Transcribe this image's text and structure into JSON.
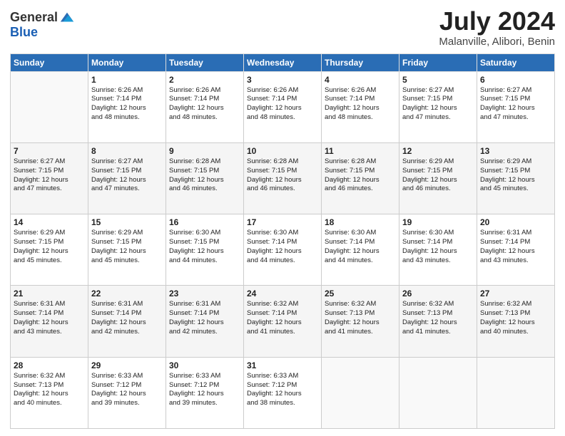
{
  "logo": {
    "general": "General",
    "blue": "Blue"
  },
  "title": {
    "month_year": "July 2024",
    "location": "Malanville, Alibori, Benin"
  },
  "headers": [
    "Sunday",
    "Monday",
    "Tuesday",
    "Wednesday",
    "Thursday",
    "Friday",
    "Saturday"
  ],
  "weeks": [
    [
      {
        "day": "",
        "info": ""
      },
      {
        "day": "1",
        "info": "Sunrise: 6:26 AM\nSunset: 7:14 PM\nDaylight: 12 hours\nand 48 minutes."
      },
      {
        "day": "2",
        "info": "Sunrise: 6:26 AM\nSunset: 7:14 PM\nDaylight: 12 hours\nand 48 minutes."
      },
      {
        "day": "3",
        "info": "Sunrise: 6:26 AM\nSunset: 7:14 PM\nDaylight: 12 hours\nand 48 minutes."
      },
      {
        "day": "4",
        "info": "Sunrise: 6:26 AM\nSunset: 7:14 PM\nDaylight: 12 hours\nand 48 minutes."
      },
      {
        "day": "5",
        "info": "Sunrise: 6:27 AM\nSunset: 7:15 PM\nDaylight: 12 hours\nand 47 minutes."
      },
      {
        "day": "6",
        "info": "Sunrise: 6:27 AM\nSunset: 7:15 PM\nDaylight: 12 hours\nand 47 minutes."
      }
    ],
    [
      {
        "day": "7",
        "info": "Sunrise: 6:27 AM\nSunset: 7:15 PM\nDaylight: 12 hours\nand 47 minutes."
      },
      {
        "day": "8",
        "info": "Sunrise: 6:27 AM\nSunset: 7:15 PM\nDaylight: 12 hours\nand 47 minutes."
      },
      {
        "day": "9",
        "info": "Sunrise: 6:28 AM\nSunset: 7:15 PM\nDaylight: 12 hours\nand 46 minutes."
      },
      {
        "day": "10",
        "info": "Sunrise: 6:28 AM\nSunset: 7:15 PM\nDaylight: 12 hours\nand 46 minutes."
      },
      {
        "day": "11",
        "info": "Sunrise: 6:28 AM\nSunset: 7:15 PM\nDaylight: 12 hours\nand 46 minutes."
      },
      {
        "day": "12",
        "info": "Sunrise: 6:29 AM\nSunset: 7:15 PM\nDaylight: 12 hours\nand 46 minutes."
      },
      {
        "day": "13",
        "info": "Sunrise: 6:29 AM\nSunset: 7:15 PM\nDaylight: 12 hours\nand 45 minutes."
      }
    ],
    [
      {
        "day": "14",
        "info": "Sunrise: 6:29 AM\nSunset: 7:15 PM\nDaylight: 12 hours\nand 45 minutes."
      },
      {
        "day": "15",
        "info": "Sunrise: 6:29 AM\nSunset: 7:15 PM\nDaylight: 12 hours\nand 45 minutes."
      },
      {
        "day": "16",
        "info": "Sunrise: 6:30 AM\nSunset: 7:15 PM\nDaylight: 12 hours\nand 44 minutes."
      },
      {
        "day": "17",
        "info": "Sunrise: 6:30 AM\nSunset: 7:14 PM\nDaylight: 12 hours\nand 44 minutes."
      },
      {
        "day": "18",
        "info": "Sunrise: 6:30 AM\nSunset: 7:14 PM\nDaylight: 12 hours\nand 44 minutes."
      },
      {
        "day": "19",
        "info": "Sunrise: 6:30 AM\nSunset: 7:14 PM\nDaylight: 12 hours\nand 43 minutes."
      },
      {
        "day": "20",
        "info": "Sunrise: 6:31 AM\nSunset: 7:14 PM\nDaylight: 12 hours\nand 43 minutes."
      }
    ],
    [
      {
        "day": "21",
        "info": "Sunrise: 6:31 AM\nSunset: 7:14 PM\nDaylight: 12 hours\nand 43 minutes."
      },
      {
        "day": "22",
        "info": "Sunrise: 6:31 AM\nSunset: 7:14 PM\nDaylight: 12 hours\nand 42 minutes."
      },
      {
        "day": "23",
        "info": "Sunrise: 6:31 AM\nSunset: 7:14 PM\nDaylight: 12 hours\nand 42 minutes."
      },
      {
        "day": "24",
        "info": "Sunrise: 6:32 AM\nSunset: 7:14 PM\nDaylight: 12 hours\nand 41 minutes."
      },
      {
        "day": "25",
        "info": "Sunrise: 6:32 AM\nSunset: 7:13 PM\nDaylight: 12 hours\nand 41 minutes."
      },
      {
        "day": "26",
        "info": "Sunrise: 6:32 AM\nSunset: 7:13 PM\nDaylight: 12 hours\nand 41 minutes."
      },
      {
        "day": "27",
        "info": "Sunrise: 6:32 AM\nSunset: 7:13 PM\nDaylight: 12 hours\nand 40 minutes."
      }
    ],
    [
      {
        "day": "28",
        "info": "Sunrise: 6:32 AM\nSunset: 7:13 PM\nDaylight: 12 hours\nand 40 minutes."
      },
      {
        "day": "29",
        "info": "Sunrise: 6:33 AM\nSunset: 7:12 PM\nDaylight: 12 hours\nand 39 minutes."
      },
      {
        "day": "30",
        "info": "Sunrise: 6:33 AM\nSunset: 7:12 PM\nDaylight: 12 hours\nand 39 minutes."
      },
      {
        "day": "31",
        "info": "Sunrise: 6:33 AM\nSunset: 7:12 PM\nDaylight: 12 hours\nand 38 minutes."
      },
      {
        "day": "",
        "info": ""
      },
      {
        "day": "",
        "info": ""
      },
      {
        "day": "",
        "info": ""
      }
    ]
  ]
}
